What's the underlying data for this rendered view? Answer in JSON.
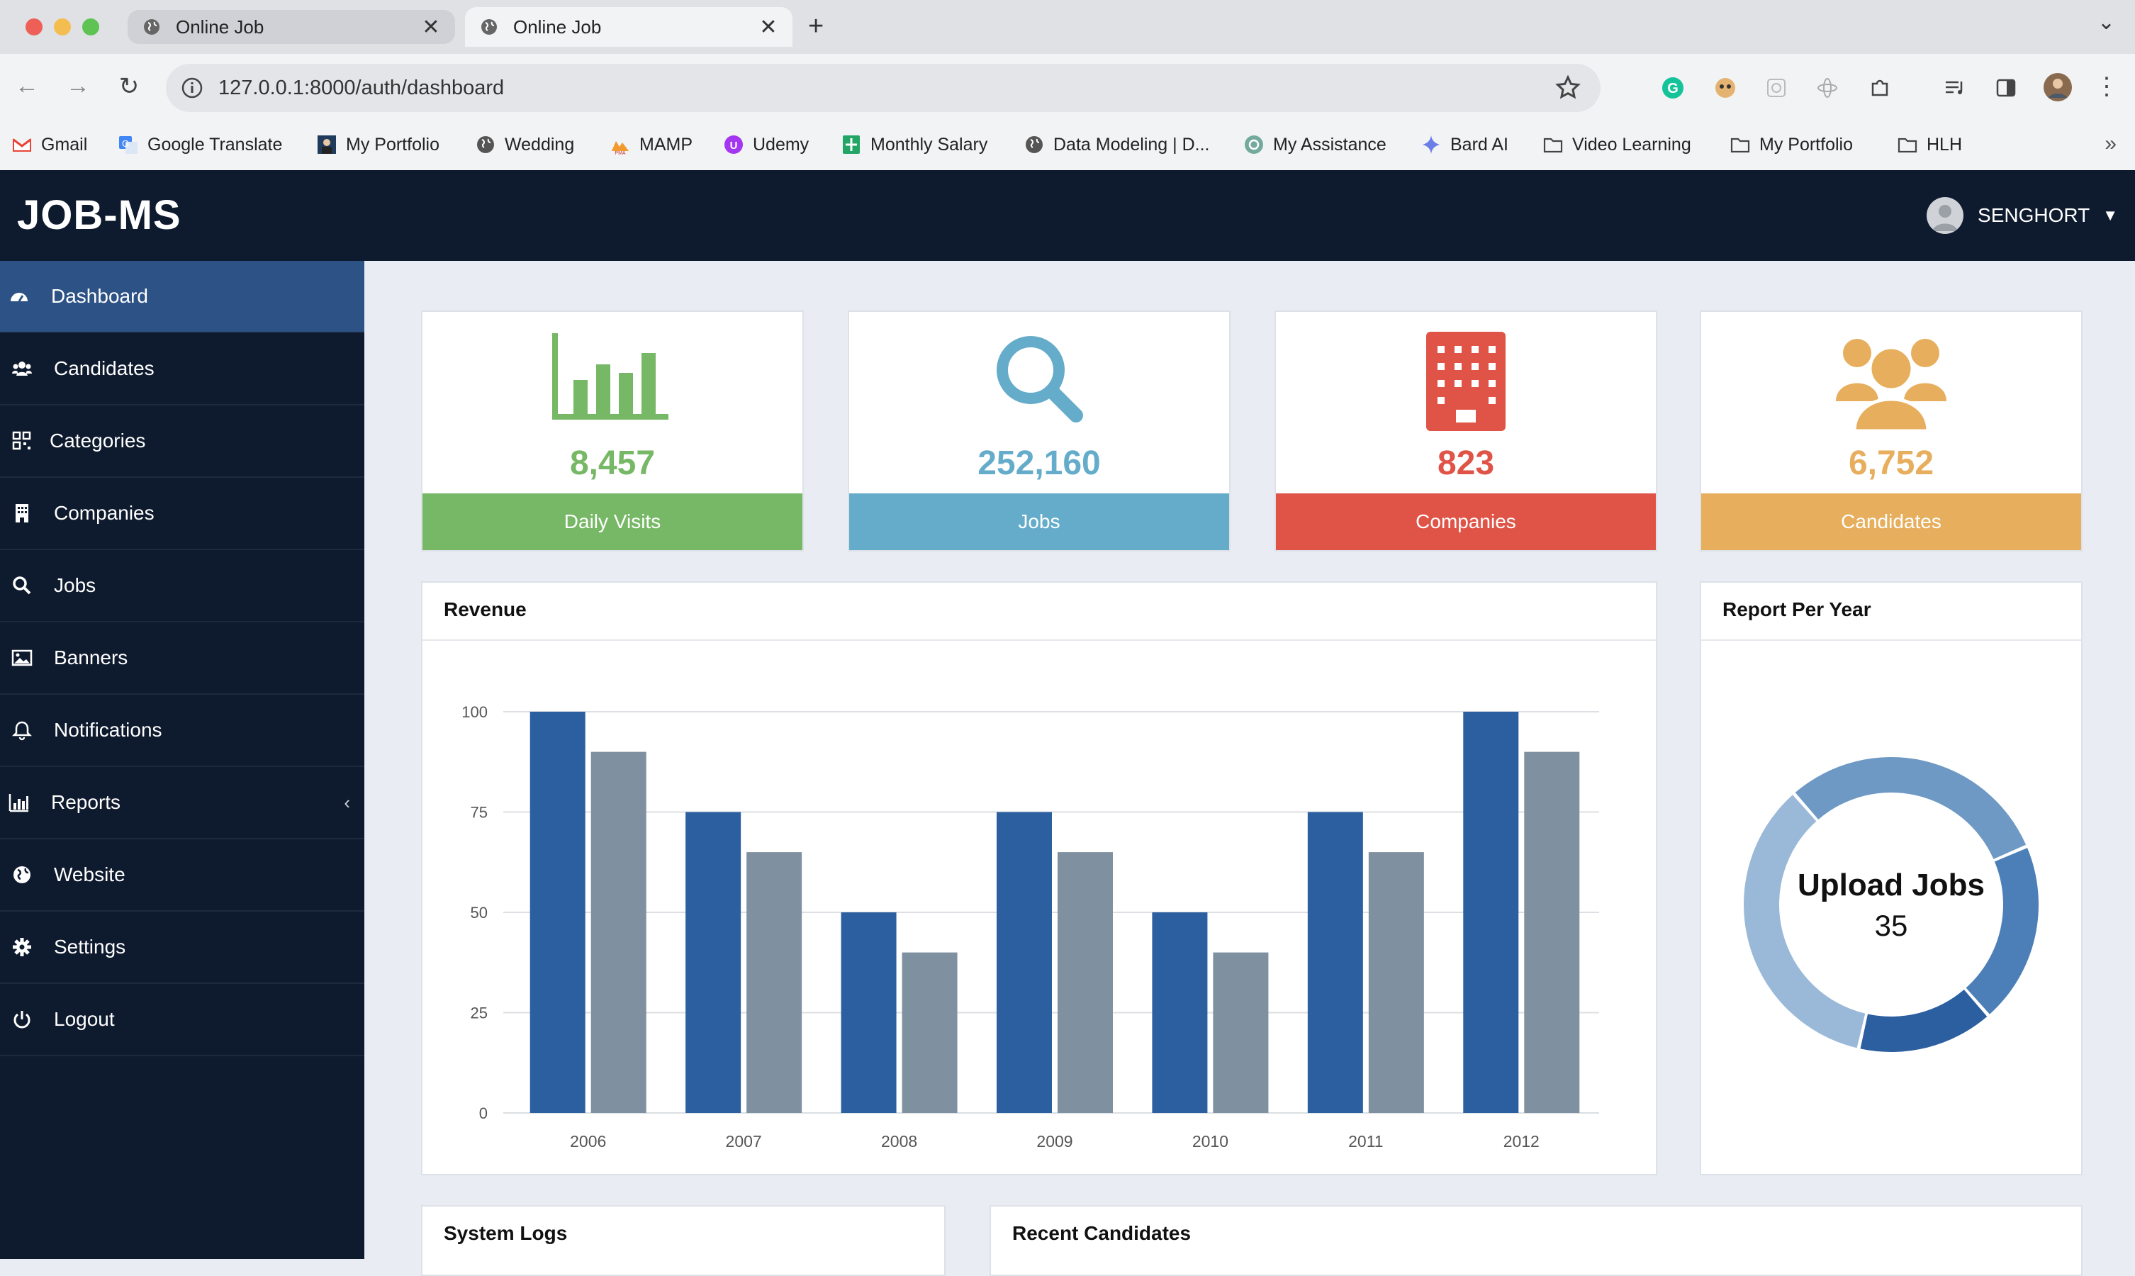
{
  "browser": {
    "tabs": [
      {
        "title": "Online Job"
      },
      {
        "title": "Online Job"
      }
    ],
    "url": "127.0.0.1:8000/auth/dashboard",
    "bookmarks": [
      {
        "label": "Gmail"
      },
      {
        "label": "Google Translate"
      },
      {
        "label": "My Portfolio"
      },
      {
        "label": "Wedding"
      },
      {
        "label": "MAMP"
      },
      {
        "label": "Udemy"
      },
      {
        "label": "Monthly Salary"
      },
      {
        "label": "Data Modeling | D..."
      },
      {
        "label": "My Assistance"
      },
      {
        "label": "Bard AI"
      },
      {
        "label": "Video Learning"
      },
      {
        "label": "My Portfolio"
      },
      {
        "label": "HLH"
      }
    ]
  },
  "app": {
    "logo": "JOB-MS",
    "user": "SENGHORT"
  },
  "sidebar": {
    "items": [
      {
        "label": "Dashboard",
        "icon": "dashboard-icon"
      },
      {
        "label": "Candidates",
        "icon": "users-icon"
      },
      {
        "label": "Categories",
        "icon": "grid-icon"
      },
      {
        "label": "Companies",
        "icon": "building-icon"
      },
      {
        "label": "Jobs",
        "icon": "search-icon"
      },
      {
        "label": "Banners",
        "icon": "image-icon"
      },
      {
        "label": "Notifications",
        "icon": "bell-icon"
      },
      {
        "label": "Reports",
        "icon": "bar-chart-icon"
      },
      {
        "label": "Website",
        "icon": "globe-icon"
      },
      {
        "label": "Settings",
        "icon": "gear-icon"
      },
      {
        "label": "Logout",
        "icon": "power-icon"
      }
    ]
  },
  "stats": [
    {
      "value": "8,457",
      "label": "Daily Visits",
      "color": "#76b865"
    },
    {
      "value": "252,160",
      "label": "Jobs",
      "color": "#65acca"
    },
    {
      "value": "823",
      "label": "Companies",
      "color": "#df5446"
    },
    {
      "value": "6,752",
      "label": "Candidates",
      "color": "#e7ae5d"
    }
  ],
  "revenue": {
    "title": "Revenue"
  },
  "report": {
    "title": "Report Per Year",
    "center_label": "Upload Jobs",
    "center_value": "35"
  },
  "bottom": {
    "logs_title": "System Logs",
    "candidates_title": "Recent Candidates"
  },
  "colors": {
    "primary": "#2c5fa0",
    "secondary": "#7f90a0",
    "nav": "#0e1a2d",
    "active": "#2c5286"
  },
  "chart_data": [
    {
      "type": "bar",
      "title": "Revenue",
      "categories": [
        "2006",
        "2007",
        "2008",
        "2009",
        "2010",
        "2011",
        "2012"
      ],
      "series": [
        {
          "values": [
            100,
            75,
            50,
            75,
            50,
            75,
            100
          ],
          "color": "#2c5fa0"
        },
        {
          "values": [
            90,
            65,
            40,
            65,
            40,
            65,
            90
          ],
          "color": "#7f90a0"
        }
      ],
      "ylim": [
        0,
        100
      ],
      "yticks": [
        0,
        25,
        50,
        75,
        100
      ],
      "grid": true
    },
    {
      "type": "pie",
      "title": "Report Per Year",
      "values": [
        30,
        20,
        15,
        35
      ],
      "colors": [
        "#6e99c4",
        "#4c7fb7",
        "#2c5fa0",
        "#9ab9d8"
      ]
    }
  ]
}
